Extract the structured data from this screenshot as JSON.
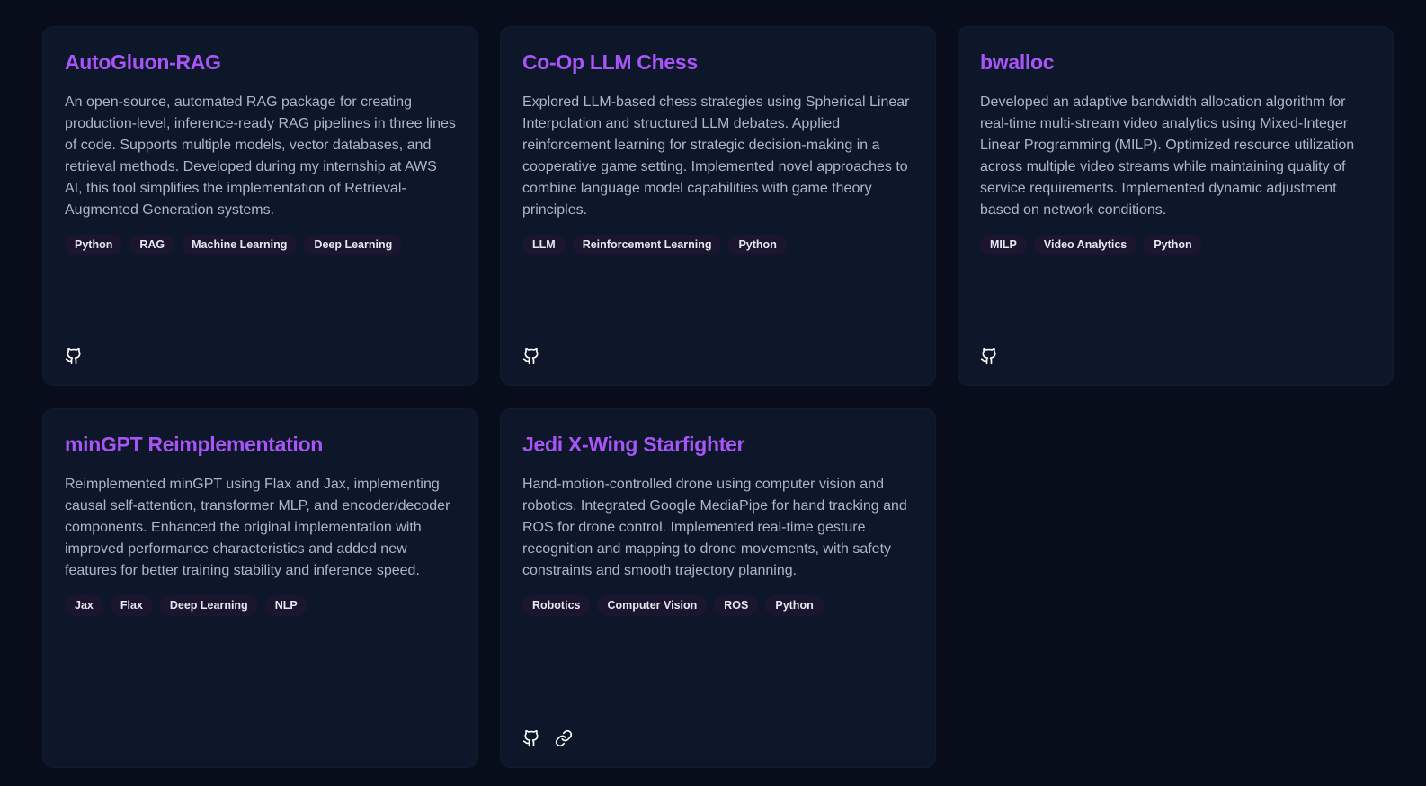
{
  "projects": [
    {
      "title": "AutoGluon-RAG",
      "description": "An open-source, automated RAG package for creating production-level, inference-ready RAG pipelines in three lines of code. Supports multiple models, vector databases, and retrieval methods. Developed during my internship at AWS AI, this tool simplifies the implementation of Retrieval-Augmented Generation systems.",
      "tags": [
        "Python",
        "RAG",
        "Machine Learning",
        "Deep Learning"
      ],
      "links": [
        "github-icon"
      ]
    },
    {
      "title": "Co-Op LLM Chess",
      "description": "Explored LLM-based chess strategies using Spherical Linear Interpolation and structured LLM debates. Applied reinforcement learning for strategic decision-making in a cooperative game setting. Implemented novel approaches to combine language model capabilities with game theory principles.",
      "tags": [
        "LLM",
        "Reinforcement Learning",
        "Python"
      ],
      "links": [
        "github-icon"
      ]
    },
    {
      "title": "bwalloc",
      "description": "Developed an adaptive bandwidth allocation algorithm for real-time multi-stream video analytics using Mixed-Integer Linear Programming (MILP). Optimized resource utilization across multiple video streams while maintaining quality of service requirements. Implemented dynamic adjustment based on network conditions.",
      "tags": [
        "MILP",
        "Video Analytics",
        "Python"
      ],
      "links": [
        "github-icon"
      ]
    },
    {
      "title": "minGPT Reimplementation",
      "description": "Reimplemented minGPT using Flax and Jax, implementing causal self-attention, transformer MLP, and encoder/decoder components. Enhanced the original implementation with improved performance characteristics and added new features for better training stability and inference speed.",
      "tags": [
        "Jax",
        "Flax",
        "Deep Learning",
        "NLP"
      ],
      "links": []
    },
    {
      "title": "Jedi X-Wing Starfighter",
      "description": "Hand-motion-controlled drone using computer vision and robotics. Integrated Google MediaPipe for hand tracking and ROS for drone control. Implemented real-time gesture recognition and mapping to drone movements, with safety constraints and smooth trajectory planning.",
      "tags": [
        "Robotics",
        "Computer Vision",
        "ROS",
        "Python"
      ],
      "links": [
        "github-icon",
        "link-icon"
      ]
    }
  ],
  "colors": {
    "accent": "#a855f7",
    "background": "#070d1a",
    "card": "#0d1729",
    "tag": "#1b1530"
  }
}
